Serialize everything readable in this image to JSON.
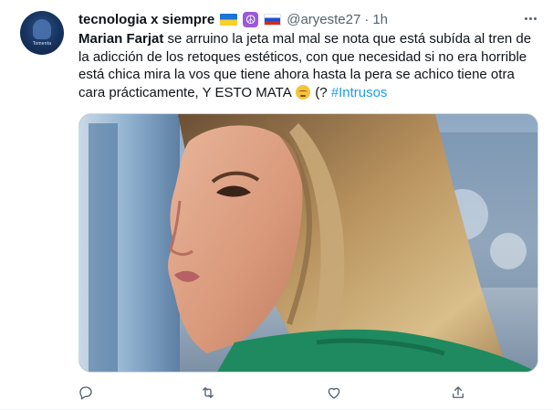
{
  "tweet": {
    "display_name": "tecnologia x siempre",
    "handle": "@aryeste27",
    "separator": "·",
    "time": "1h",
    "avatar_text": "Tomenta",
    "text": {
      "mention": "Marian Farjat",
      "body": " se arruino la jeta mal mal se nota que está subída al tren de la adicción de los retoques estéticos, con que necesidad si no era horrible está chica mira la vos que tiene ahora hasta la pera se achico tiene otra cara prácticamente, Y ESTO MATA ",
      "after_emoji": " (? ",
      "hashtag": "#Intrusos"
    },
    "badges": {
      "flag_1": "ukraine-flag",
      "symbol": "peace-symbol",
      "flag_2": "russia-flag"
    }
  },
  "media": {
    "description_icon": "photo-woman-profile"
  },
  "actions": [
    {
      "name": "reply",
      "icon": "reply-icon"
    },
    {
      "name": "retweet",
      "icon": "retweet-icon"
    },
    {
      "name": "like",
      "icon": "like-icon"
    },
    {
      "name": "share",
      "icon": "share-icon"
    }
  ],
  "colors": {
    "accent": "#1d9bf0",
    "text_primary": "#0f1419",
    "text_secondary": "#536471"
  }
}
